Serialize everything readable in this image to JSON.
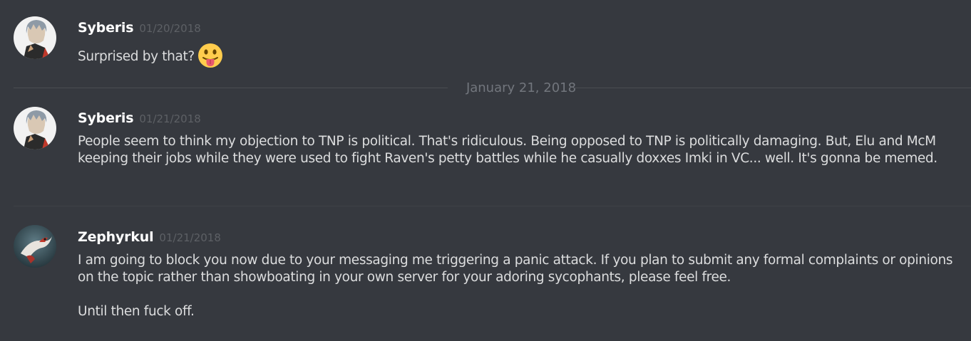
{
  "messages": [
    {
      "author": "Syberis",
      "timestamp": "01/20/2018",
      "text": "Surprised by that?",
      "emoji": "stuck-out-tongue-emoji"
    },
    {
      "author": "Syberis",
      "timestamp": "01/21/2018",
      "text": "People seem to think my objection to TNP is political. That's ridiculous. Being opposed to TNP is politically damaging. But, Elu and McM keeping their jobs while they were used to fight Raven's petty battles while he casually doxxes Imki in VC... well. It's gonna be memed."
    },
    {
      "author": "Zephyrkul",
      "timestamp": "01/21/2018",
      "paragraphs": [
        "I am going to block you now due to your messaging me triggering a panic attack. If you plan to submit any formal complaints or opinions on the topic rather than showboating in your own server for your adoring sycophants, please feel free.",
        "Until then fuck off."
      ]
    }
  ],
  "date_divider": "January 21, 2018",
  "colors": {
    "background": "#36393f",
    "username": "#ffffff",
    "timestamp": "#5d6065",
    "message_text": "#dcddde",
    "divider": "#4a4d52"
  }
}
